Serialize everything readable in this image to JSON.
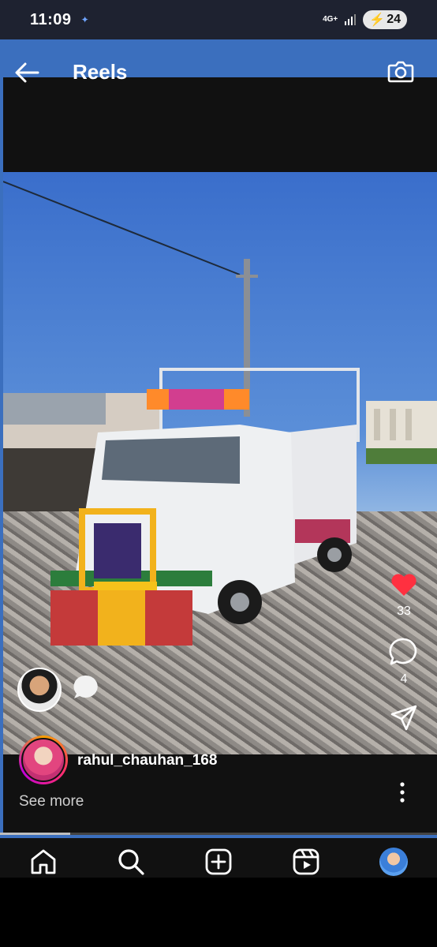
{
  "status_bar": {
    "time": "11:09",
    "network": "4G+",
    "battery": "24"
  },
  "header": {
    "title": "Reels"
  },
  "reel": {
    "likes": "33",
    "comments": "4",
    "author": "rahul_chauhan_168",
    "see_more": "See more",
    "progress": 0.16
  },
  "colors": {
    "like": "#ff3040",
    "sky": "#3b6fbe",
    "bar": "#111111"
  },
  "icons": [
    "back-arrow-icon",
    "camera-icon",
    "heart-icon",
    "comment-icon",
    "share-icon",
    "more-options-icon",
    "home-icon",
    "search-icon",
    "create-icon",
    "reels-icon"
  ]
}
